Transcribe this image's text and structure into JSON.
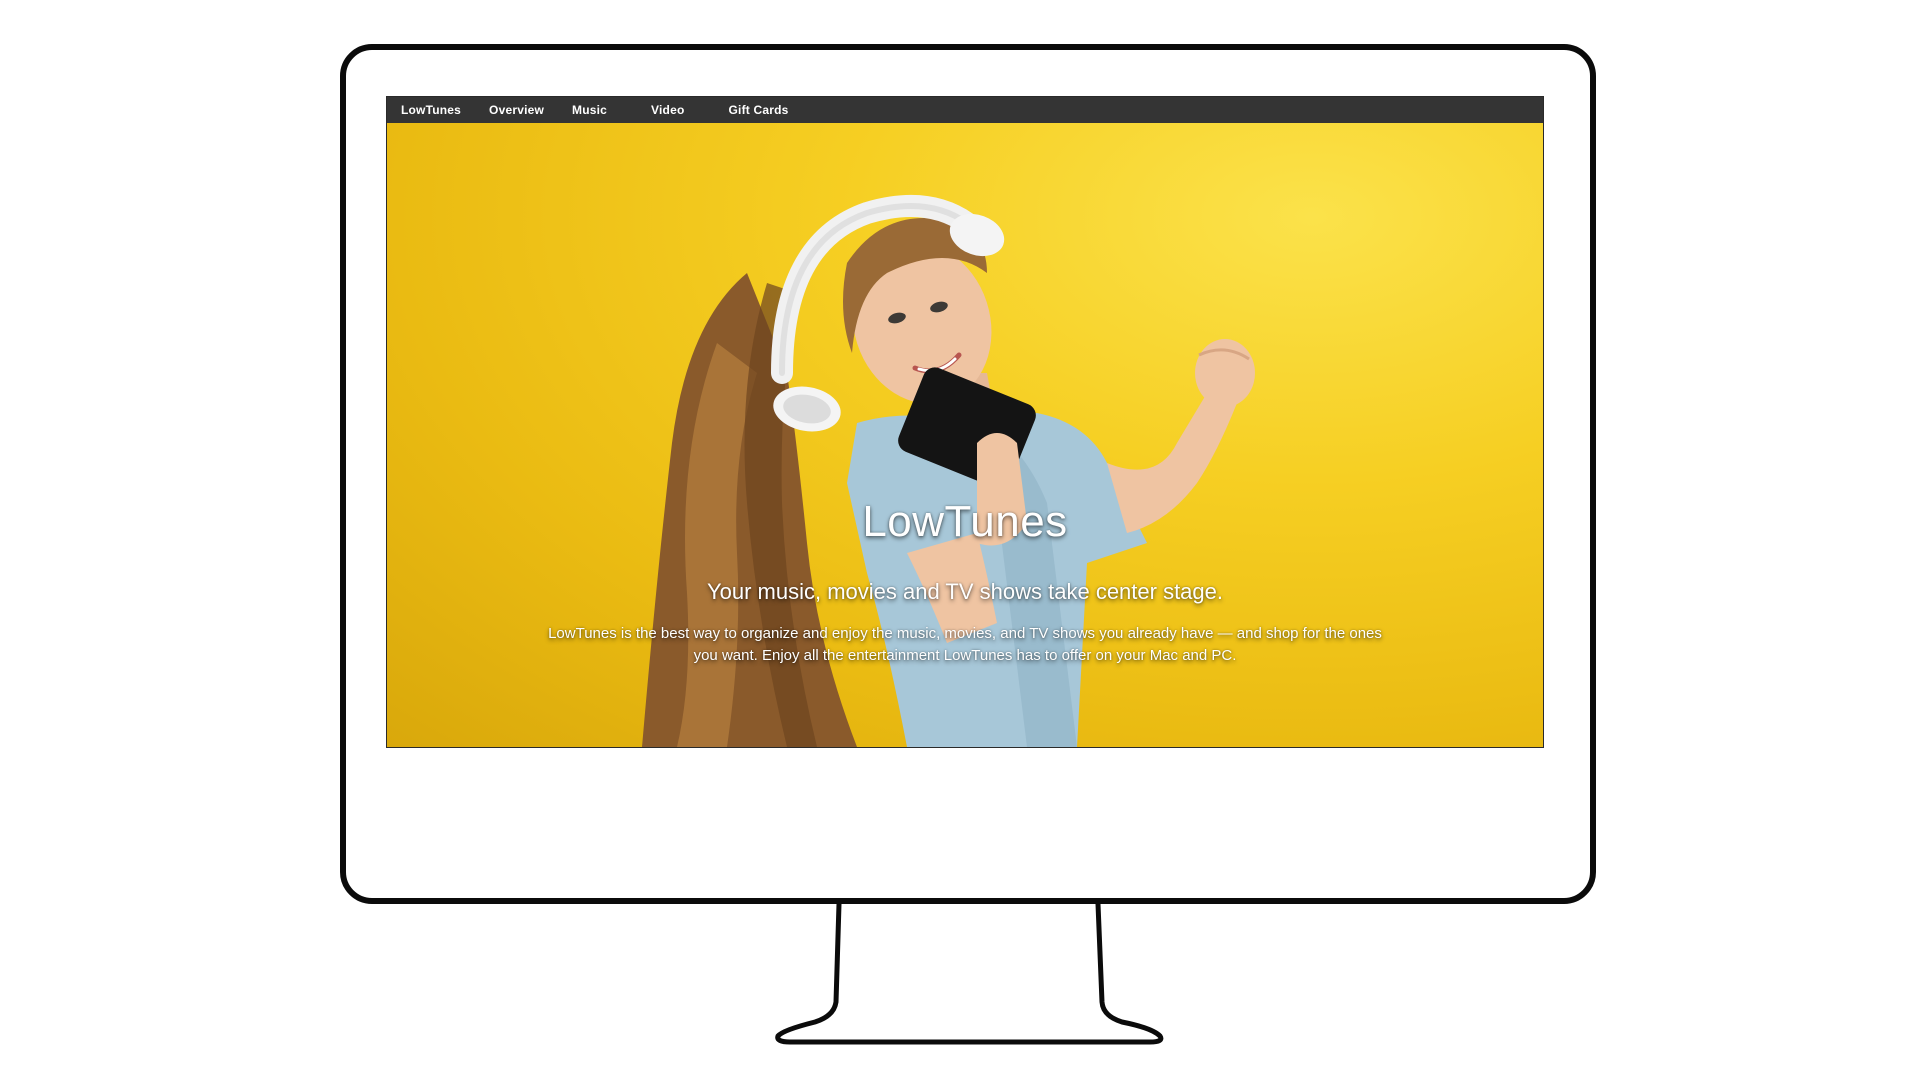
{
  "nav": {
    "items": [
      {
        "label": "LowTunes"
      },
      {
        "label": "Overview"
      },
      {
        "label": "Music"
      },
      {
        "label": "Video"
      },
      {
        "label": "Gift Cards"
      }
    ]
  },
  "hero": {
    "title": "LowTunes",
    "subtitle": "Your music, movies and TV shows take center stage.",
    "description": "LowTunes is the best way to organize and enjoy the music, movies, and TV shows you already have — and shop for the ones you want. Enjoy all the entertainment LowTunes has to offer on your Mac and PC."
  },
  "colors": {
    "navbar": "#343434",
    "hero_background": "#f2c10f",
    "text": "#ffffff",
    "monitor_outline": "#0b0b0b"
  }
}
